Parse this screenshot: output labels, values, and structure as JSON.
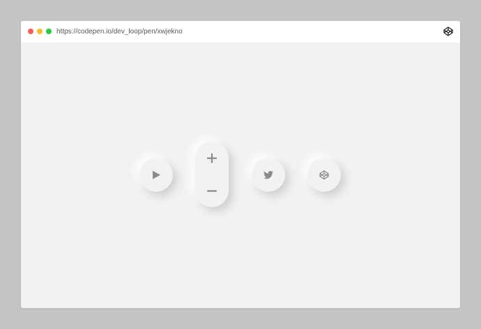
{
  "browser": {
    "url": "https://codepen.io/dev_loop/pen/xwjekno",
    "window_controls": {
      "close_color": "#ff5f57",
      "minimize_color": "#febc2e",
      "maximize_color": "#28c840"
    },
    "logo_icon": "codepen-logo-icon"
  },
  "colors": {
    "surface": "#f2f2f2",
    "icon": "#8a8a8a",
    "backdrop": "#c4c4c4"
  },
  "controls": {
    "play_icon": "play-icon",
    "increment_icon": "plus-icon",
    "decrement_icon": "minus-icon",
    "twitter_icon": "twitter-icon",
    "codepen_icon": "codepen-icon"
  }
}
